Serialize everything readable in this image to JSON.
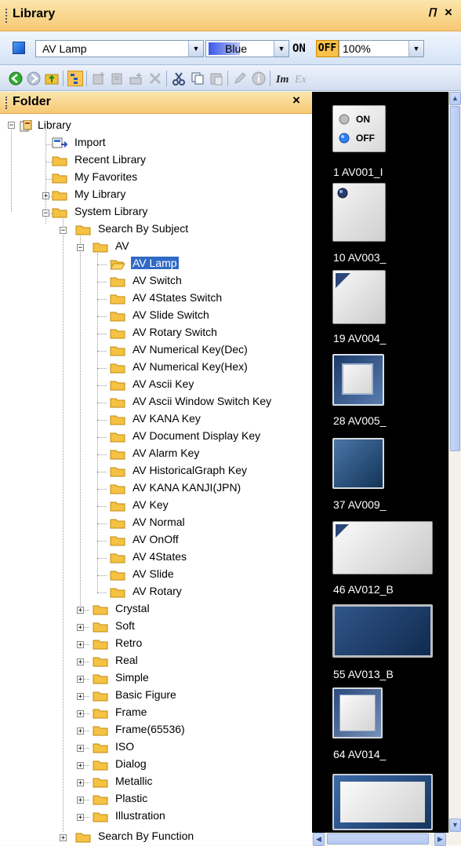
{
  "panel": {
    "title": "Library",
    "pin": "p",
    "close": "×"
  },
  "toolbar": {
    "item_combo": "AV Lamp",
    "color_combo": "Blue",
    "on_label": "ON",
    "off_label": "OFF",
    "zoom_combo": "100%"
  },
  "folder_panel": {
    "title": "Folder",
    "close": "×"
  },
  "tree": {
    "root": "Library",
    "import": "Import",
    "recent": "Recent Library",
    "favorites": "My Favorites",
    "my_library": "My Library",
    "system_library": "System Library",
    "search_by_subject": "Search By Subject",
    "av": "AV",
    "av_items": [
      "AV Lamp",
      "AV Switch",
      "AV 4States Switch",
      "AV Slide Switch",
      "AV Rotary Switch",
      "AV Numerical Key(Dec)",
      "AV Numerical Key(Hex)",
      "AV Ascii Key",
      "AV Ascii Window Switch Key",
      "AV KANA Key",
      "AV Document Display Key",
      "AV Alarm Key",
      "AV HistoricalGraph Key",
      "AV KANA KANJI(JPN)",
      "AV Key",
      "AV Normal",
      "AV OnOff",
      "AV 4States",
      "AV Slide",
      "AV Rotary"
    ],
    "subjects": [
      "Crystal",
      "Soft",
      "Retro",
      "Real",
      "Simple",
      "Basic Figure",
      "Frame",
      "Frame(65536)",
      "ISO",
      "Dialog",
      "Metallic",
      "Plastic",
      "Illustration"
    ],
    "search_by_function": "Search By Function"
  },
  "preview": {
    "lamp_on": "ON",
    "lamp_off": "OFF",
    "captions": [
      "1 AV001_I",
      "10 AV003_",
      "19 AV004_",
      "28 AV005_",
      "37 AV009_",
      "46 AV012_B",
      "55 AV013_B",
      "64 AV014_"
    ]
  }
}
